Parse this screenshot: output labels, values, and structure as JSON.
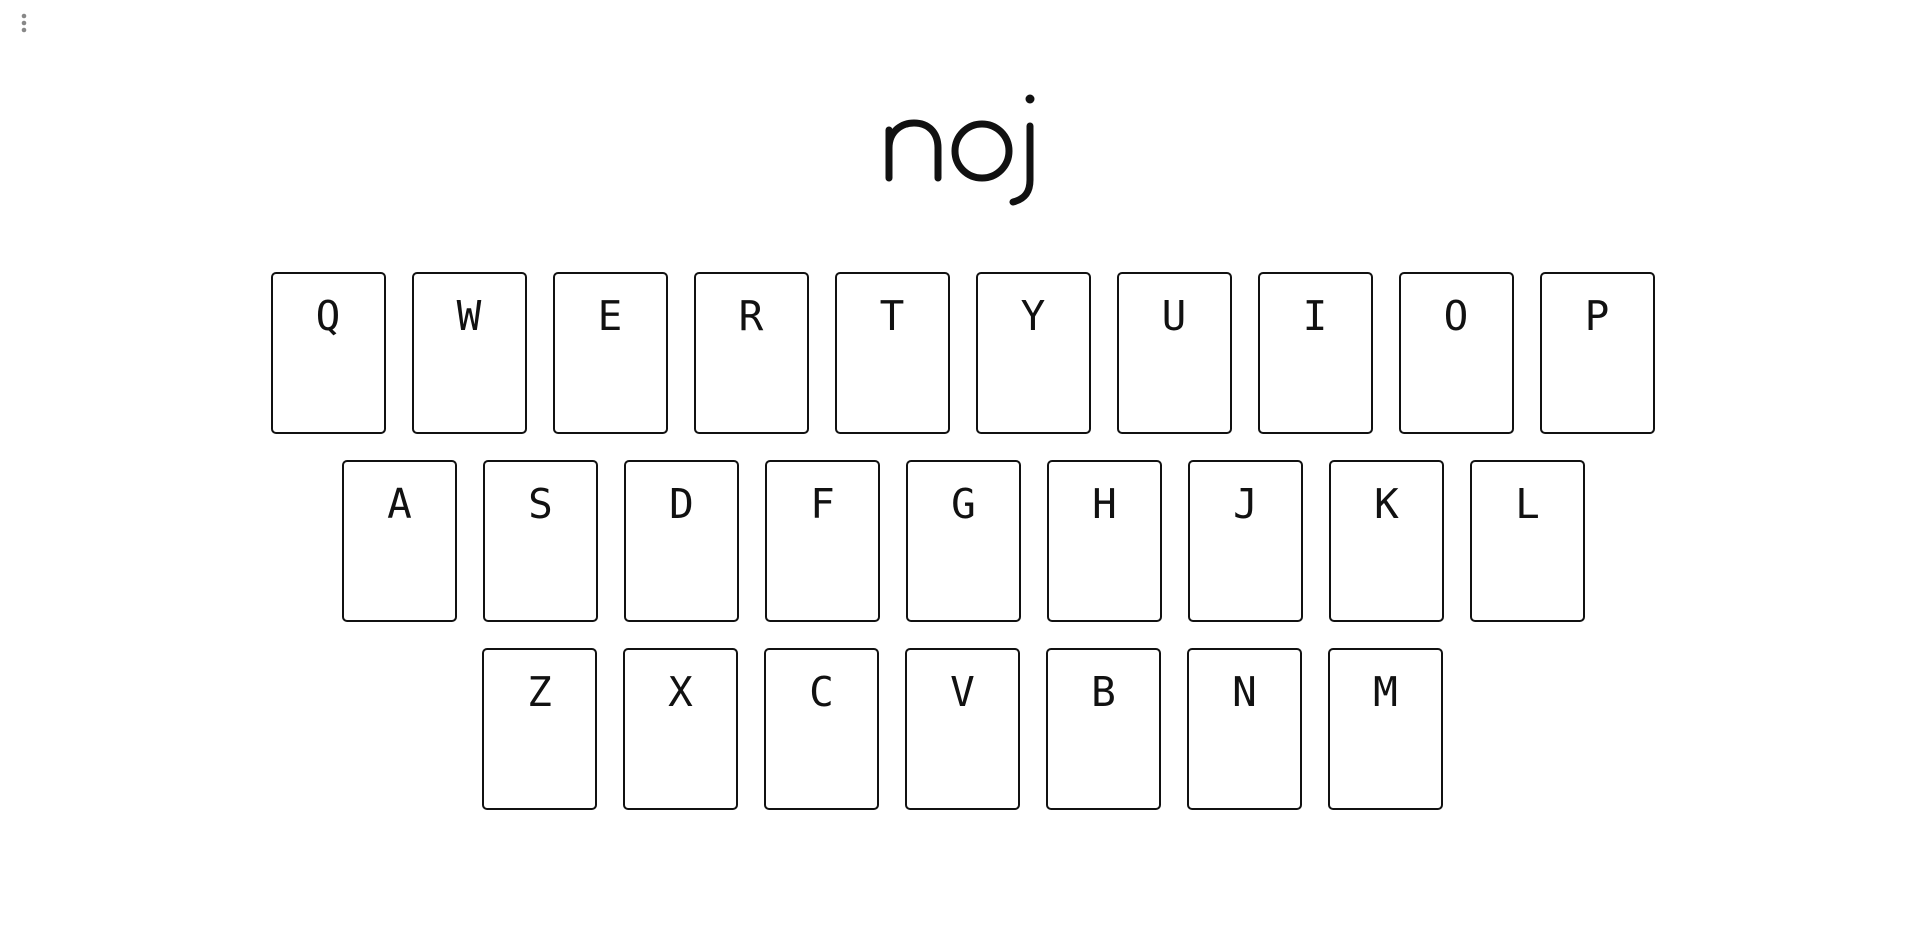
{
  "app": {
    "logo_text": "noj",
    "menu_icon": "vertical-ellipsis-icon"
  },
  "colors": {
    "background": "#ffffff",
    "key_border": "#111111",
    "text": "#111111",
    "menu_dots": "#888888"
  },
  "keyboard": {
    "rows": [
      [
        "Q",
        "W",
        "E",
        "R",
        "T",
        "Y",
        "U",
        "I",
        "O",
        "P"
      ],
      [
        "A",
        "S",
        "D",
        "F",
        "G",
        "H",
        "J",
        "K",
        "L"
      ],
      [
        "Z",
        "X",
        "C",
        "V",
        "B",
        "N",
        "M"
      ]
    ]
  }
}
